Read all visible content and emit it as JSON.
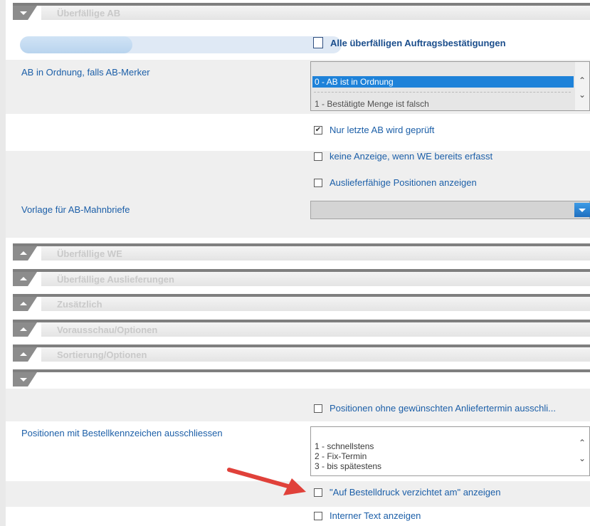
{
  "sections": {
    "overdue_ab": "Überfällige AB",
    "overdue_we": "Überfällige WE",
    "overdue_deliveries": "Überfällige Auslieferungen",
    "additional": "Zusätzlich",
    "preview": "Vorausschau/Optionen",
    "sorting": "Sortierung/Optionen"
  },
  "ab_section": {
    "all_overdue_label": "Alle überfälligen Auftragsbestätigungen",
    "progress_fraction": 0.35,
    "ab_ok_label": "AB in Ordnung, falls AB-Merker",
    "ab_marker_options": [
      "0 - AB ist in Ordnung",
      "1 - Bestätigte Menge ist falsch"
    ],
    "ab_marker_selected": "0 - AB ist in Ordnung",
    "only_last_ab": {
      "label": "Nur letzte AB wird geprüft",
      "checked": true
    },
    "no_display_we": {
      "label": "keine Anzeige, wenn WE bereits erfasst",
      "checked": false
    },
    "deliverable_positions": {
      "label": "Auslieferfähige Positionen anzeigen",
      "checked": false
    },
    "template_label": "Vorlage für AB-Mahnbriefe",
    "template_value": ""
  },
  "bottom_section": {
    "exclude_no_date": {
      "label": "Positionen ohne gewünschten Anliefertermin ausschli...",
      "checked": false
    },
    "exclude_order_label": "Positionen mit Bestellkennzeichen ausschliessen",
    "order_flags": [
      "1 - schnellstens",
      "2 - Fix-Termin",
      "3 - bis spätestens"
    ],
    "waived_print": {
      "label": "\"Auf Bestelldruck verzichtet am\" anzeigen",
      "checked": false
    },
    "internal_text": {
      "label": "Interner Text anzeigen",
      "checked": false
    }
  },
  "colors": {
    "accent": "#1c5fa8",
    "selection": "#1e82d9",
    "arrow": "#e0413a"
  },
  "icons": {
    "scroll_up": "chevron-up-icon",
    "scroll_down": "chevron-down-icon",
    "dropdown": "chevron-down-icon",
    "pointer": "red-arrow-icon"
  }
}
